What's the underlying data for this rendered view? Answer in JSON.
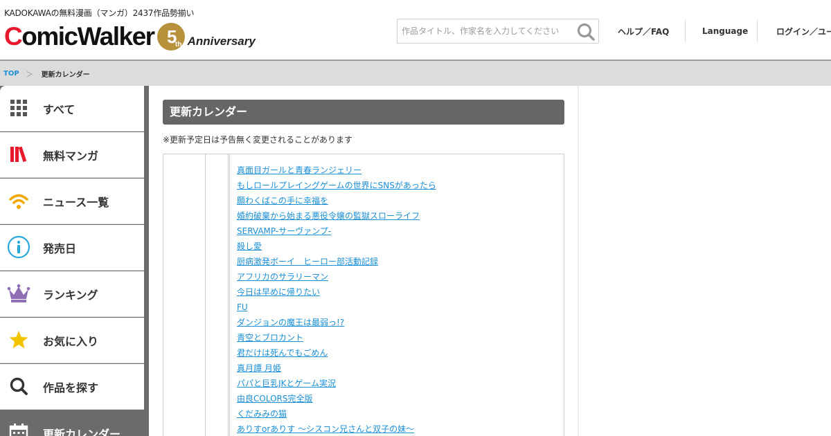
{
  "header": {
    "tagline": "KADOKAWAの無料漫画（マンガ）2437作品勢揃い",
    "logo": {
      "first_letter": "C",
      "rest": "omicWalker",
      "badge_number": "5",
      "badge_suffix": "th",
      "anniversary": "Anniversary"
    },
    "search": {
      "placeholder": "作品タイトル、作家名を入力してください",
      "value": ""
    },
    "nav": {
      "help": "ヘルプ／FAQ",
      "language": "Language",
      "login": "ログイン／ユー"
    }
  },
  "breadcrumb": {
    "top": "TOP",
    "separator": "＞",
    "current": "更新カレンダー"
  },
  "sidebar": {
    "items": [
      {
        "label": "すべて",
        "icon": "grid-icon"
      },
      {
        "label": "無料マンガ",
        "icon": "books-icon"
      },
      {
        "label": "ニュース一覧",
        "icon": "wifi-icon"
      },
      {
        "label": "発売日",
        "icon": "info-icon"
      },
      {
        "label": "ランキング",
        "icon": "crown-icon"
      },
      {
        "label": "お気に入り",
        "icon": "star-icon"
      },
      {
        "label": "作品を探す",
        "icon": "search-icon"
      },
      {
        "label": "更新カレンダー",
        "icon": "calendar-icon"
      }
    ]
  },
  "main": {
    "title": "更新カレンダー",
    "notice": "※更新予定日は予告無く変更されることがあります",
    "titles": [
      "真面目ガールと青春ランジェリー",
      "もしロールプレイングゲームの世界にSNSがあったら",
      "願わくばこの手に幸福を",
      "婚約破棄から始まる悪役令嬢の監獄スローライフ",
      "SERVAMP-サーヴァンプ-",
      "殺し愛",
      "厨病激発ボーイ　ヒーロー部活動記録",
      "アフリカのサラリーマン",
      "今日は早めに帰りたい",
      "FU",
      "ダンジョンの魔王は最弱っ!?",
      "青空とブロカント",
      "君だけは死んでもごめん",
      "真月譚 月姫",
      "パパと巨乳JKとゲーム実況",
      "由良COLORS完全版",
      "くだみみの猫",
      "ありすorありす ～シスコン兄さんと双子の妹～"
    ]
  },
  "colors": {
    "brand_red": "#e8192c",
    "badge_gold": "#b8913c",
    "link_blue": "#1a8fd6",
    "title_bar": "#666666",
    "sidebar_active": "#6b6b6b"
  }
}
